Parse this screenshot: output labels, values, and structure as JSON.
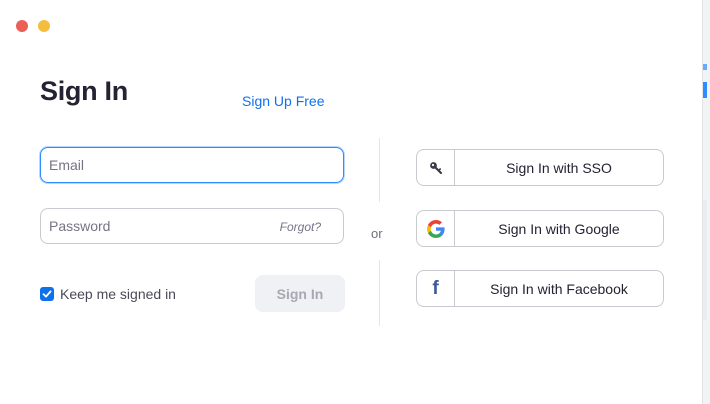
{
  "window": {
    "controls": [
      "close",
      "minimize"
    ]
  },
  "signin": {
    "title": "Sign In",
    "signup_link": "Sign Up Free",
    "email": {
      "placeholder": "Email",
      "value": ""
    },
    "password": {
      "placeholder": "Password",
      "value": ""
    },
    "forgot": "Forgot?",
    "keep_signed_in": {
      "label": "Keep me signed in",
      "checked": true
    },
    "submit": "Sign In"
  },
  "separator": "or",
  "alt_signin": [
    {
      "label": "Sign In with SSO",
      "icon": "key-icon"
    },
    {
      "label": "Sign In with Google",
      "icon": "google-icon"
    },
    {
      "label": "Sign In with Facebook",
      "icon": "facebook-icon"
    }
  ],
  "colors": {
    "accent": "#0e71eb",
    "focus_border": "#2d8cff",
    "close_light": "#ec5f57",
    "minimize_light": "#f5bd3d",
    "disabled_button_bg": "#f0f1f4",
    "facebook": "#3b5998"
  }
}
